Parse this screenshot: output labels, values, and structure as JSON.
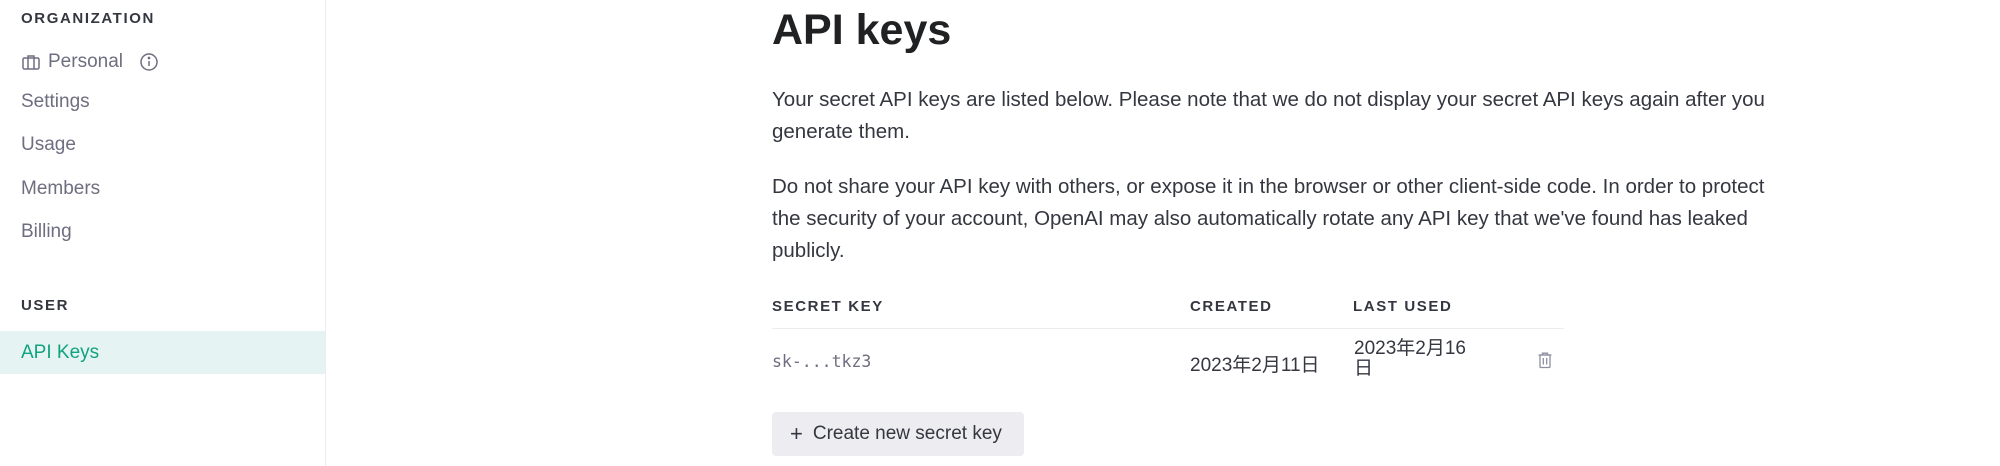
{
  "sidebar": {
    "org_header": "ORGANIZATION",
    "org_name": "Personal",
    "org_icon": "briefcase-icon",
    "info_icon": "info-icon",
    "items": [
      {
        "label": "Settings"
      },
      {
        "label": "Usage"
      },
      {
        "label": "Members"
      },
      {
        "label": "Billing"
      }
    ],
    "user_header": "USER",
    "user_items": [
      {
        "label": "API Keys",
        "active": true
      }
    ]
  },
  "main": {
    "title": "API keys",
    "paragraph1": "Your secret API keys are listed below. Please note that we do not display your secret API keys again after you generate them.",
    "paragraph2": "Do not share your API key with others, or expose it in the browser or other client-side code. In order to protect the security of your account, OpenAI may also automatically rotate any API key that we've found has leaked publicly.",
    "table": {
      "columns": [
        "SECRET KEY",
        "CREATED",
        "LAST USED"
      ],
      "rows": [
        {
          "key": "sk-...tkz3",
          "created": "2023年2月11日",
          "last_used": "2023年2月16日",
          "delete_icon": "trash-icon"
        }
      ]
    },
    "create_button": {
      "icon": "+",
      "label": "Create new secret key"
    }
  },
  "colors": {
    "accent": "#10a37f",
    "active_bg": "#e6f3f3",
    "button_bg": "#ececf1",
    "text": "#353740",
    "muted": "#6e6e80"
  }
}
